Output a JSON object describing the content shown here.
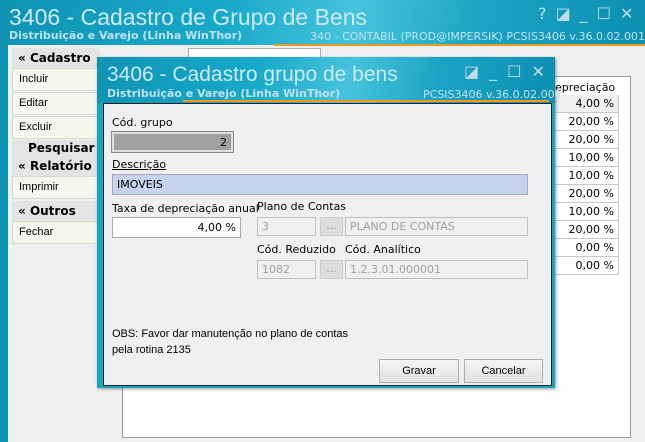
{
  "main": {
    "title": "3406 - Cadastro de Grupo de Bens",
    "subtitle": "Distribuição e Varejo (Linha WinThor)",
    "info": "340 - CONTABIL (PROD@IMPERSIK)   PCSIS3406  v.36.0.02.001",
    "controls": [
      "?",
      "◪",
      "_",
      "☐",
      "✕"
    ]
  },
  "sidebar": {
    "groups": [
      {
        "label": "Cadastro",
        "items": [
          "Incluir",
          "Editar",
          "Excluir"
        ]
      },
      {
        "label": "Pesquisar",
        "items": []
      },
      {
        "label": "Relatório",
        "items": [
          "Imprimir"
        ]
      },
      {
        "label": "Outros",
        "items": [
          "Fechar"
        ]
      }
    ]
  },
  "grid": {
    "header": "epreciação",
    "rows": [
      "4,00 %",
      "20,00 %",
      "20,00 %",
      "10,00 %",
      "10,00 %",
      "20,00 %",
      "10,00 %",
      "20,00 %",
      "0,00 %",
      "0,00 %"
    ]
  },
  "dialog": {
    "title": "3406 - Cadastro grupo de bens",
    "subtitle": "Distribuição e Varejo (Linha WinThor)",
    "info": "PCSIS3406  v.36.0.02.001",
    "controls": [
      "◪",
      "_",
      "☐",
      "✕"
    ],
    "cod_grupo_label": "Cód. grupo",
    "cod_grupo": "2",
    "descricao_label": "Descrição",
    "descricao": "IMOVEIS",
    "taxa_label": "Taxa de depreciação anual",
    "taxa": "4,00 %",
    "plano_label": "Plano de Contas",
    "plano_cod": "3",
    "plano_nome": "PLANO DE CONTAS",
    "reduzido_label": "Cód. Reduzido",
    "reduzido": "1082",
    "analitico_label": "Cód. Analítico",
    "analitico": "1.2.3.01.000001",
    "dots": "...",
    "obs_line1": "OBS: Favor dar manutenção no plano de contas",
    "obs_line2": "pela rotina 2135",
    "gravar": "Gravar",
    "cancelar": "Cancelar"
  },
  "colors": {
    "titlebar": "#18a9c9",
    "accent_underline": "#f39a1e",
    "descricao_bg": "#c5d3ec"
  }
}
